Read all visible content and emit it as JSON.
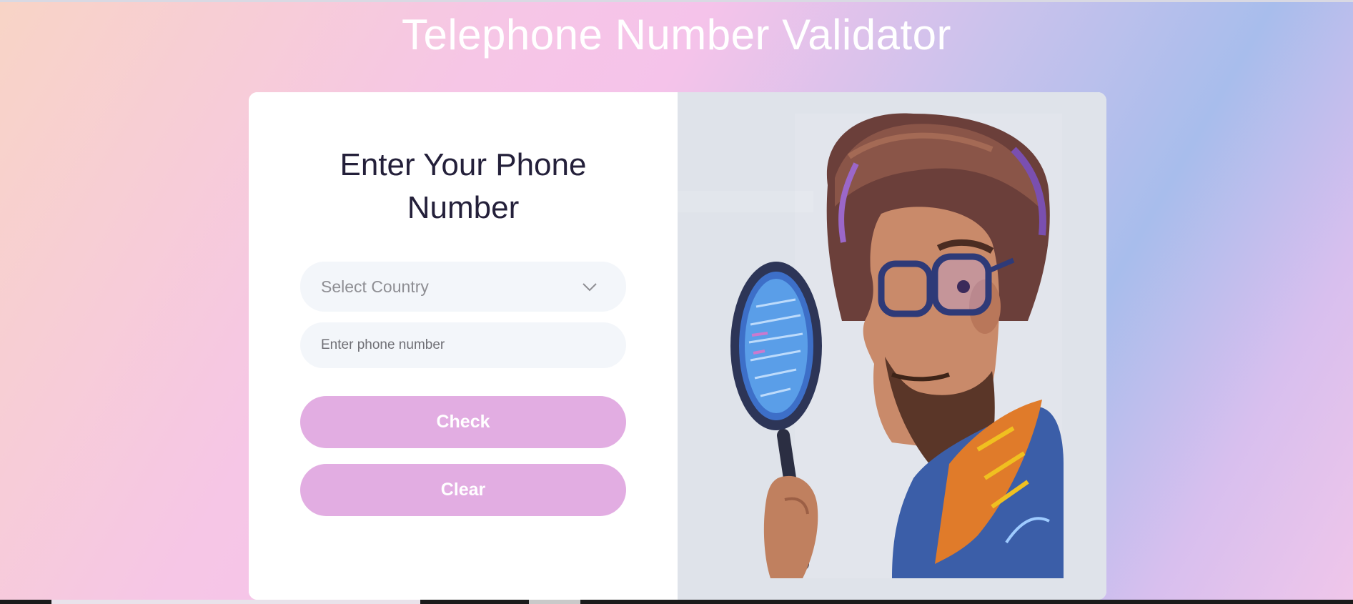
{
  "page": {
    "title": "Telephone Number Validator"
  },
  "form": {
    "heading": "Enter Your Phone Number",
    "country_select": {
      "placeholder": "Select Country"
    },
    "phone_input": {
      "placeholder": "Enter phone number",
      "value": ""
    },
    "check_label": "Check",
    "clear_label": "Clear"
  },
  "image": {
    "alt": "Illustration of a man looking through a magnifying glass at code"
  },
  "icons": {
    "dropdown": "chevron-down-icon",
    "magnifier": "magnifying-glass-icon"
  },
  "colors": {
    "button_bg": "#e2ade2",
    "field_bg": "#f3f6fa",
    "heading_text": "#24203a",
    "image_bg": "#dfe3ea"
  }
}
